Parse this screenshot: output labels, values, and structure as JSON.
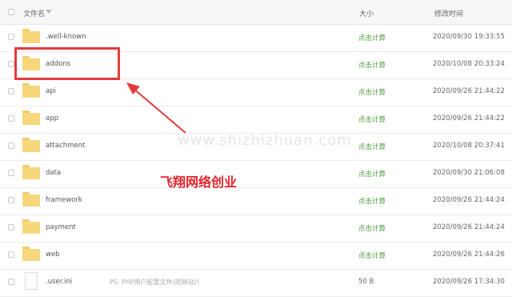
{
  "header": {
    "name_label": "文件名",
    "size_label": "大小",
    "time_label": "修改时间"
  },
  "rows": [
    {
      "name": ".well-known",
      "size": "点击计算",
      "time": "2020/09/30 19:33:55",
      "type": "folder"
    },
    {
      "name": "addons",
      "size": "点击计算",
      "time": "2020/10/08 20:33:24",
      "type": "folder"
    },
    {
      "name": "api",
      "size": "点击计算",
      "time": "2020/09/26 21:44:22",
      "type": "folder"
    },
    {
      "name": "app",
      "size": "点击计算",
      "time": "2020/09/26 21:44:22",
      "type": "folder"
    },
    {
      "name": "attachment",
      "size": "点击计算",
      "time": "2020/10/08 20:37:41",
      "type": "folder"
    },
    {
      "name": "data",
      "size": "点击计算",
      "time": "2020/09/30 21:06:08",
      "type": "folder"
    },
    {
      "name": "framework",
      "size": "点击计算",
      "time": "2020/09/26 21:44:24",
      "type": "folder"
    },
    {
      "name": "payment",
      "size": "点击计算",
      "time": "2020/09/26 21:44:24",
      "type": "folder"
    },
    {
      "name": "web",
      "size": "点击计算",
      "time": "2020/09/26 21:44:26",
      "type": "folder"
    },
    {
      "name": ".user.ini",
      "note": "PS: PHP用户配置文件(防跨站)!",
      "size": "50 B",
      "time": "2020/09/26 17:34:30",
      "type": "file"
    }
  ],
  "annotation": {
    "watermark": "www.shizhizhuan.com",
    "caption": "飞翔网络创业",
    "color": "#e33b3b"
  }
}
